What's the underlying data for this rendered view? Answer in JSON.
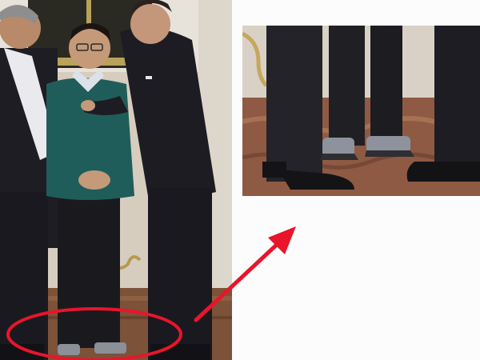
{
  "scene": {
    "main_photo": "photo",
    "inset_photo": "photo"
  },
  "annotation": {
    "ellipse_color": "#e8152b",
    "arrow_color": "#e8152b"
  },
  "colors": {
    "wall": "#d9d2c6",
    "floor": "#8a5a3c",
    "suit": "#1c1b22",
    "sweater": "#1f5f5c",
    "shirt": "#d9dde6",
    "skin": "#c79b7a",
    "socks": "#8a8f98"
  }
}
